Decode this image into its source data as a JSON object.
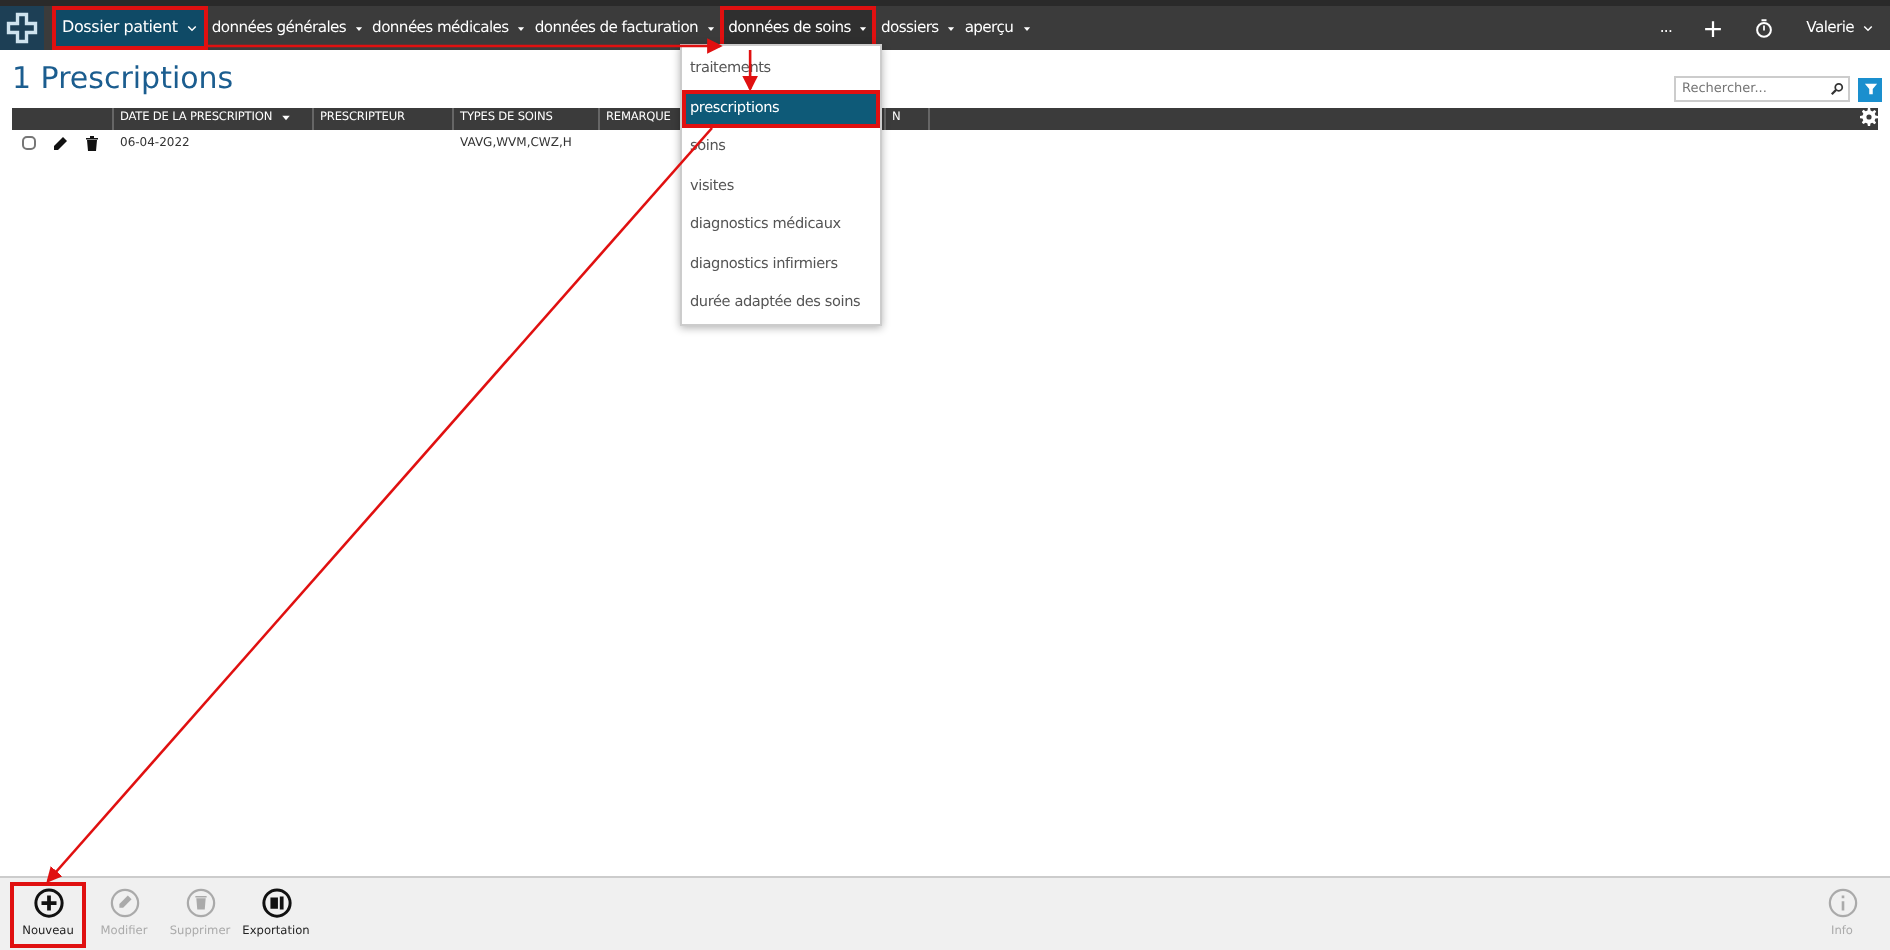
{
  "navbar": {
    "patient_menu": {
      "label": "Dossier patient",
      "highlighted": true
    },
    "items": [
      {
        "label": "données générales",
        "highlighted": false,
        "open": false
      },
      {
        "label": "données médicales",
        "highlighted": false,
        "open": false
      },
      {
        "label": "données de facturation",
        "highlighted": false,
        "open": false
      },
      {
        "label": "données de soins",
        "highlighted": true,
        "open": true
      },
      {
        "label": "dossiers",
        "highlighted": false,
        "open": false
      },
      {
        "label": "aperçu",
        "highlighted": false,
        "open": false
      }
    ],
    "more": "...",
    "user": "Valerie"
  },
  "dropdown": [
    {
      "label": "traitements",
      "selected": false,
      "highlighted": false
    },
    {
      "label": "prescriptions",
      "selected": true,
      "highlighted": true
    },
    {
      "label": "soins",
      "selected": false,
      "highlighted": false
    },
    {
      "label": "visites",
      "selected": false,
      "highlighted": false
    },
    {
      "label": "diagnostics médicaux",
      "selected": false,
      "highlighted": false
    },
    {
      "label": "diagnostics infirmiers",
      "selected": false,
      "highlighted": false
    },
    {
      "label": "durée adaptée des soins",
      "selected": false,
      "highlighted": false
    }
  ],
  "title": "1 Prescriptions",
  "search": {
    "placeholder": "Rechercher..."
  },
  "table": {
    "columns": [
      {
        "label": "DATE DE LA PRESCRIPTION",
        "sorted": true
      },
      {
        "label": "PRESCRIPTEUR"
      },
      {
        "label": "TYPES DE SOINS"
      },
      {
        "label": "REMARQUE"
      },
      {
        "label": "N"
      }
    ],
    "rows": [
      {
        "checked": false,
        "cells": [
          "06-04-2022",
          "",
          "VAVG,WVM,CWZ,H",
          "",
          ""
        ]
      }
    ]
  },
  "toolbar": [
    {
      "label": "Nouveau",
      "kind": "plus",
      "disabled": false,
      "highlighted": true
    },
    {
      "label": "Modifier",
      "kind": "pencil",
      "disabled": true,
      "highlighted": false
    },
    {
      "label": "Supprimer",
      "kind": "trash",
      "disabled": true,
      "highlighted": false
    },
    {
      "label": "Exportation",
      "kind": "export",
      "disabled": false,
      "highlighted": false
    }
  ],
  "info": {
    "label": "Info",
    "disabled": true
  },
  "annotations": {
    "arrows": true
  }
}
